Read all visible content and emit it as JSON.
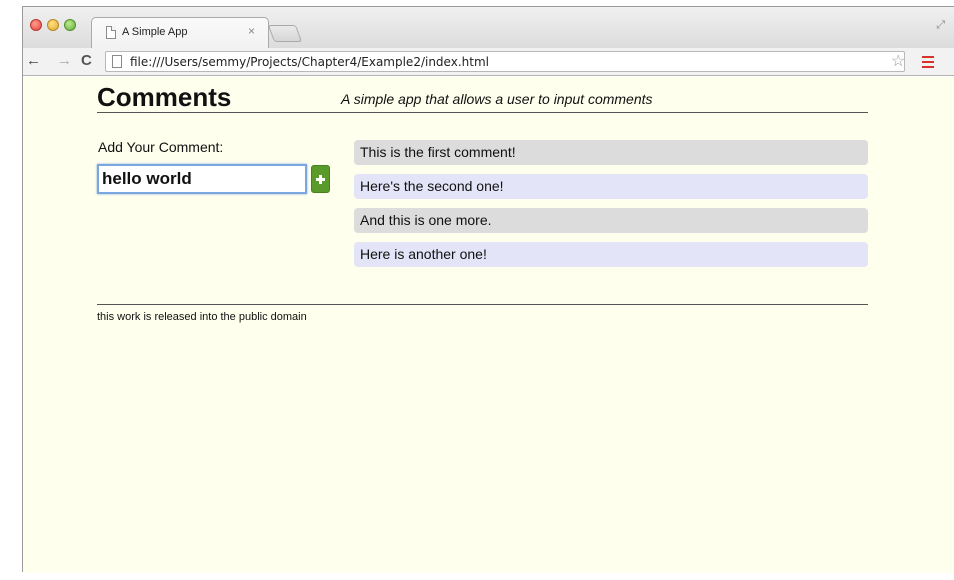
{
  "browser": {
    "tab_title": "A Simple App",
    "tab_close": "×",
    "url": "file:///Users/semmy/Projects/Chapter4/Example2/index.html"
  },
  "icons": {
    "back": "arrow-left-icon",
    "forward": "arrow-right-icon",
    "reload": "reload-icon",
    "bookmark": "star-icon",
    "menu": "hamburger-menu-icon",
    "add": "plus-icon"
  },
  "colors": {
    "page_background": "#ffffee",
    "add_button": "#5a9a2b",
    "comment_gray": "#dcdcdc",
    "comment_lavender": "#e4e4f8",
    "input_focus_border": "#7aa7e0"
  },
  "header": {
    "title": "Comments",
    "tagline": "A simple app that allows a user to input comments"
  },
  "form": {
    "label": "Add Your Comment:",
    "input_value": "hello world"
  },
  "comments": [
    {
      "text": "This is the first comment!"
    },
    {
      "text": "Here's the second one!"
    },
    {
      "text": "And this is one more."
    },
    {
      "text": "Here is another one!"
    }
  ],
  "footer": {
    "text": "this work is released into the public domain"
  }
}
